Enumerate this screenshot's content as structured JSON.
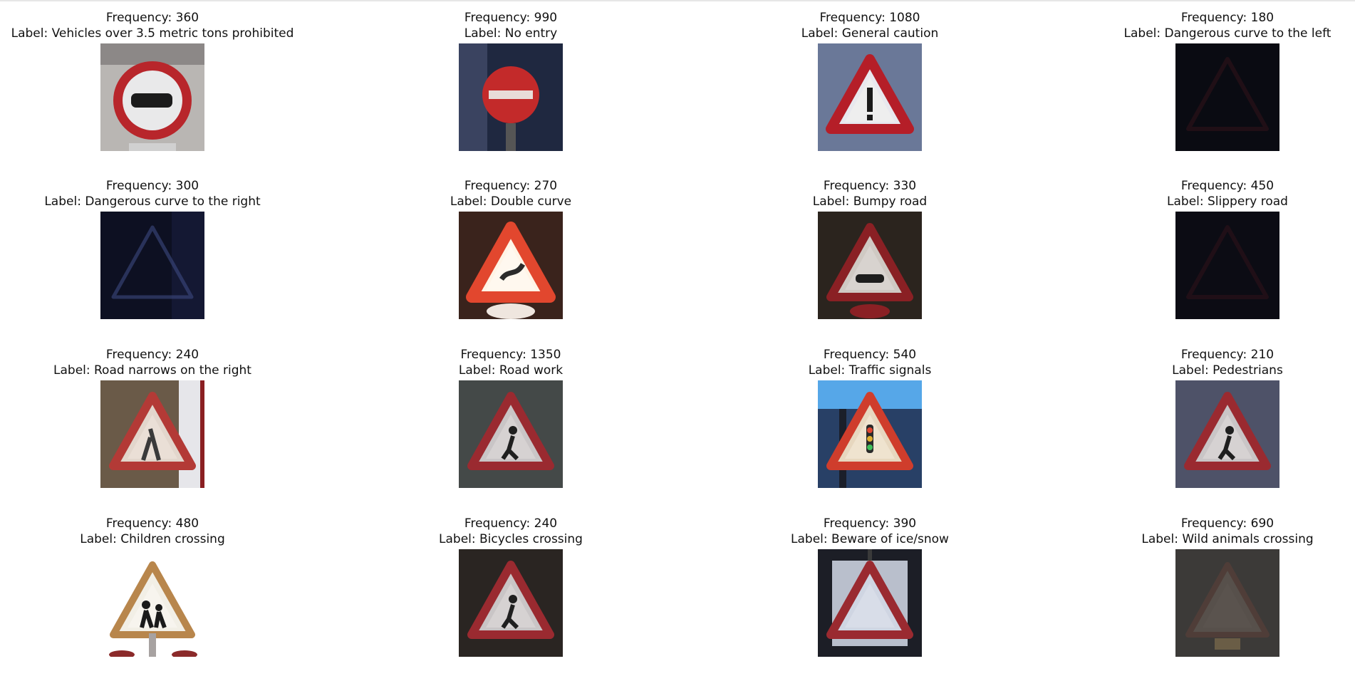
{
  "figure": {
    "panels": [
      {
        "frequency": "Frequency: 360",
        "label": "Label: Vehicles over 3.5 metric tons prohibited",
        "icon": "no-trucks-sign-icon",
        "bg": "#b9b6b3",
        "style": "circle-truck"
      },
      {
        "frequency": "Frequency: 990",
        "label": "Label: No entry",
        "icon": "no-entry-sign-icon",
        "bg": "#1f2840",
        "style": "no-entry"
      },
      {
        "frequency": "Frequency: 1080",
        "label": "Label: General caution",
        "icon": "general-caution-sign-icon",
        "bg": "#6a7898",
        "style": "tri-exclaim"
      },
      {
        "frequency": "Frequency: 180",
        "label": "Label: Dangerous curve to the left",
        "icon": "curve-left-sign-icon",
        "bg": "#0a0b12",
        "style": "dark-triangle"
      },
      {
        "frequency": "Frequency: 300",
        "label": "Label: Dangerous curve to the right",
        "icon": "curve-right-sign-icon",
        "bg": "#0d1022",
        "style": "dark-triangle-blue"
      },
      {
        "frequency": "Frequency: 270",
        "label": "Label: Double curve",
        "icon": "double-curve-sign-icon",
        "bg": "#3a231c",
        "style": "bright-triangle"
      },
      {
        "frequency": "Frequency: 330",
        "label": "Label: Bumpy road",
        "icon": "bumpy-road-sign-icon",
        "bg": "#2b241e",
        "style": "tri-bump"
      },
      {
        "frequency": "Frequency: 450",
        "label": "Label: Slippery road",
        "icon": "slippery-road-sign-icon",
        "bg": "#0c0c14",
        "style": "dark-triangle"
      },
      {
        "frequency": "Frequency: 240",
        "label": "Label: Road narrows on the right",
        "icon": "road-narrows-sign-icon",
        "bg": "#6a5a48",
        "style": "tri-side"
      },
      {
        "frequency": "Frequency: 1350",
        "label": "Label: Road work",
        "icon": "road-work-sign-icon",
        "bg": "#444948",
        "style": "tri-person"
      },
      {
        "frequency": "Frequency: 540",
        "label": "Label: Traffic signals",
        "icon": "traffic-signals-sign-icon",
        "bg": "#284066",
        "style": "tri-signals"
      },
      {
        "frequency": "Frequency: 210",
        "label": "Label: Pedestrians",
        "icon": "pedestrians-sign-icon",
        "bg": "#4e5268",
        "style": "tri-person"
      },
      {
        "frequency": "Frequency: 480",
        "label": "Label: Children crossing",
        "icon": "children-crossing-sign-icon",
        "bg": "#ffffff",
        "style": "tri-children"
      },
      {
        "frequency": "Frequency: 240",
        "label": "Label: Bicycles crossing",
        "icon": "bicycles-crossing-sign-icon",
        "bg": "#2a2522",
        "style": "tri-person"
      },
      {
        "frequency": "Frequency: 390",
        "label": "Label: Beware of ice/snow",
        "icon": "ice-snow-sign-icon",
        "bg": "#1c1e26",
        "style": "square-triangle"
      },
      {
        "frequency": "Frequency: 690",
        "label": "Label: Wild animals crossing",
        "icon": "wild-animals-sign-icon",
        "bg": "#3c3a38",
        "style": "faint-triangle"
      }
    ]
  }
}
